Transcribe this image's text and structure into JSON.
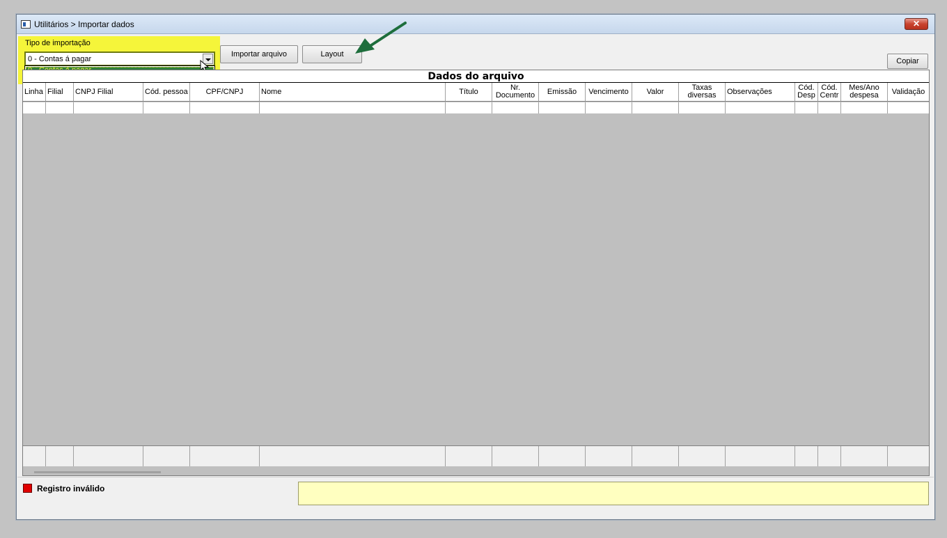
{
  "window": {
    "title": "Utilitários > Importar dados",
    "close_label": "✕"
  },
  "import": {
    "type_label": "Tipo de importação",
    "selected_value": "0 - Contas á pagar",
    "dropdown_options": [
      "0 - Contas á pagar"
    ]
  },
  "toolbar": {
    "import_file_label": "Importar arquivo",
    "layout_label": "Layout",
    "copy_label": "Copiar"
  },
  "grid": {
    "title": "Dados do arquivo",
    "columns": [
      "Linha",
      "Filial",
      "CNPJ Filial",
      "Cód. pessoa",
      "CPF/CNPJ",
      "Nome",
      "Título",
      "Nr. Documento",
      "Emissão",
      "Vencimento",
      "Valor",
      "Taxas diversas",
      "Observações",
      "Cód. Desp",
      "Cód. Centr",
      "Mes/Ano despesa",
      "Validação"
    ]
  },
  "legend": {
    "invalid_label": "Registro inválido",
    "invalid_color": "#e00000"
  },
  "colors": {
    "highlight": "#f5f53a",
    "arrow": "#1e6e3c",
    "message_panel": "#ffffc0"
  }
}
